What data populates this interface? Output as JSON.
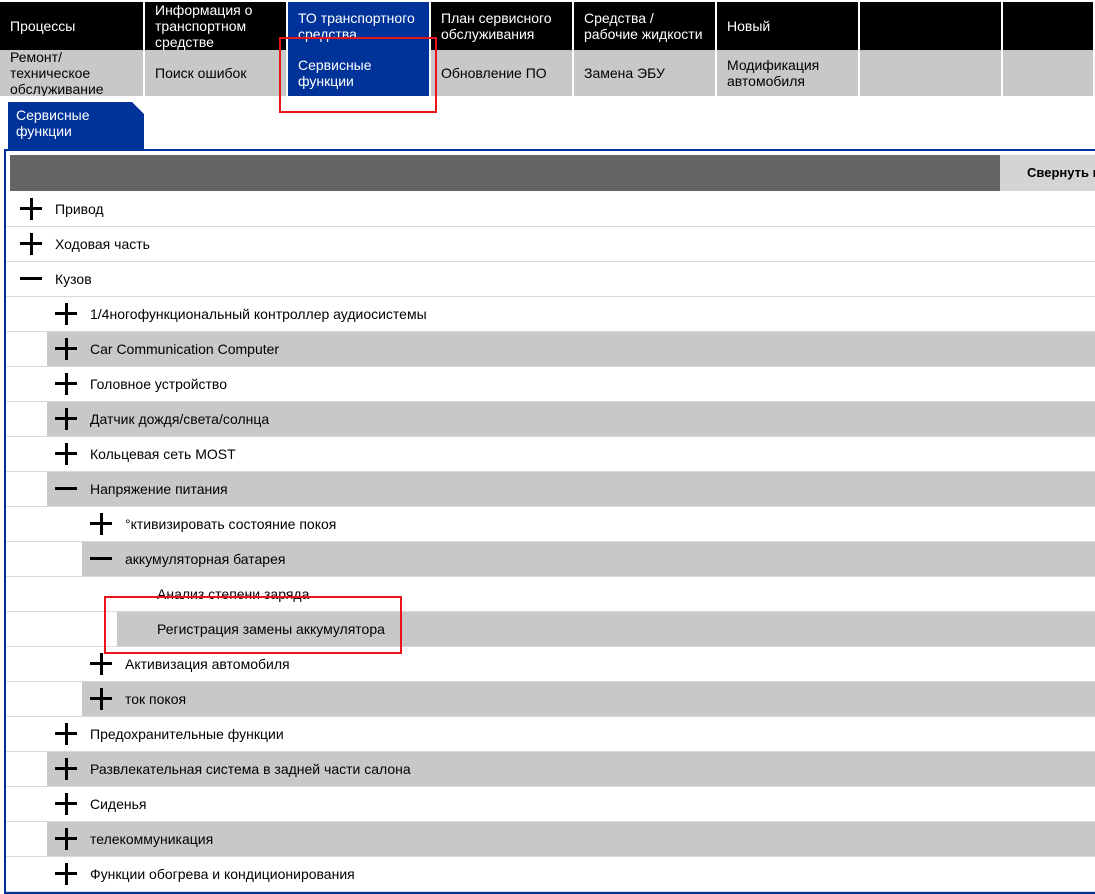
{
  "menu": {
    "items": [
      {
        "label": "Процессы",
        "active": false
      },
      {
        "label": "Информация о транспортном средстве",
        "active": false
      },
      {
        "label": "ТО транспортного средства",
        "active": true
      },
      {
        "label": "План сервисного обслуживания",
        "active": false
      },
      {
        "label": "Средства / рабочие жидкости",
        "active": false
      },
      {
        "label": "Новый",
        "active": false
      },
      {
        "label": "",
        "active": false
      },
      {
        "label": "",
        "active": false
      }
    ]
  },
  "submenu": {
    "items": [
      {
        "label": "Ремонт/ техническое обслуживание",
        "active": false
      },
      {
        "label": "Поиск ошибок",
        "active": false
      },
      {
        "label": "Сервисные функции",
        "active": true
      },
      {
        "label": "Обновление ПО",
        "active": false
      },
      {
        "label": "Замена ЭБУ",
        "active": false
      },
      {
        "label": "Модификация автомобиля",
        "active": false
      },
      {
        "label": "",
        "active": false
      },
      {
        "label": "",
        "active": false
      }
    ]
  },
  "tab": {
    "label": "Сервисные функции"
  },
  "panel": {
    "collapse_label": "Свернуть все"
  },
  "tree": [
    {
      "label": "Привод",
      "level": 0,
      "state": "collapsed",
      "shaded": false
    },
    {
      "label": "Ходовая часть",
      "level": 0,
      "state": "collapsed",
      "shaded": false
    },
    {
      "label": "Кузов",
      "level": 0,
      "state": "expanded",
      "shaded": false
    },
    {
      "label": "1/4ногофункциональный контроллер аудиосистемы",
      "level": 1,
      "state": "collapsed",
      "shaded": false
    },
    {
      "label": "Car Communication Computer",
      "level": 1,
      "state": "collapsed",
      "shaded": true
    },
    {
      "label": "Головное устройство",
      "level": 1,
      "state": "collapsed",
      "shaded": false
    },
    {
      "label": "Датчик дождя/света/солнца",
      "level": 1,
      "state": "collapsed",
      "shaded": true
    },
    {
      "label": "Кольцевая сеть MOST",
      "level": 1,
      "state": "collapsed",
      "shaded": false
    },
    {
      "label": "Напряжение питания",
      "level": 1,
      "state": "expanded",
      "shaded": true
    },
    {
      "label": "°ктивизировать состояние покоя",
      "level": 2,
      "state": "collapsed",
      "shaded": false
    },
    {
      "label": "аккумуляторная батарея",
      "level": 2,
      "state": "expanded",
      "shaded": true
    },
    {
      "label": "Анализ степени заряда",
      "level": 3,
      "state": "leaf",
      "shaded": false
    },
    {
      "label": "Регистрация замены аккумулятора",
      "level": 3,
      "state": "leaf",
      "shaded": true
    },
    {
      "label": "Активизация автомобиля",
      "level": 2,
      "state": "collapsed",
      "shaded": false
    },
    {
      "label": "ток покоя",
      "level": 2,
      "state": "collapsed",
      "shaded": true
    },
    {
      "label": "Предохранительные функции",
      "level": 1,
      "state": "collapsed",
      "shaded": false
    },
    {
      "label": "Развлекательная система в задней части салона",
      "level": 1,
      "state": "collapsed",
      "shaded": true
    },
    {
      "label": "Сиденья",
      "level": 1,
      "state": "collapsed",
      "shaded": false
    },
    {
      "label": "телекоммуникация",
      "level": 1,
      "state": "collapsed",
      "shaded": true
    },
    {
      "label": "Функции обогрева и кондиционирования",
      "level": 1,
      "state": "collapsed",
      "shaded": false
    }
  ],
  "colors": {
    "active_blue": "#003399",
    "menu_black": "#000000",
    "submenu_gray": "#c8c8c8",
    "header_gray": "#646464",
    "highlight_red": "#e8151b"
  }
}
